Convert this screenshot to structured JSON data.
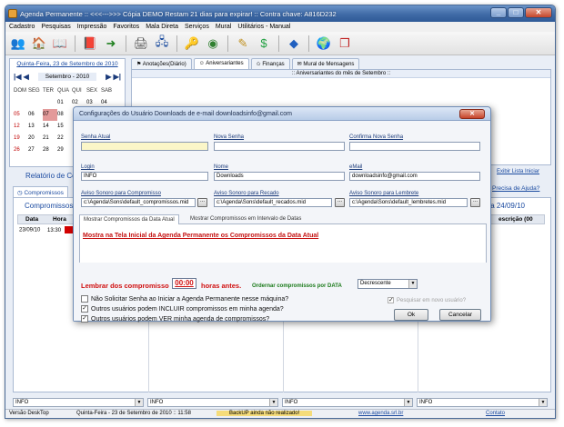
{
  "window": {
    "title": "Agenda Permanente :: <<<--->>> Cópia DEMO Restam 21 dias para expirar! :: Contra chave: A816D232",
    "min": "_",
    "max": "□",
    "close": "✕"
  },
  "menu": [
    "Cadastro",
    "Pesquisas",
    "Impressão",
    "Favoritos",
    "Mala Direta",
    "Serviços",
    "Mural",
    "Utilitários - Manual"
  ],
  "toolbar": {
    "icons": [
      {
        "name": "users-icon",
        "glyph": "👥",
        "color": "#c04010"
      },
      {
        "name": "home-icon",
        "glyph": "🏠",
        "color": "#d08020"
      },
      {
        "name": "book-icon",
        "glyph": "📖",
        "color": "#806030"
      },
      {
        "name": "notebook-icon",
        "glyph": "📕",
        "color": "#a03020"
      },
      {
        "name": "exit-icon",
        "glyph": "➜",
        "color": "#208020"
      },
      {
        "name": "printer-icon",
        "glyph": "🖨",
        "color": "#505050"
      },
      {
        "name": "network-icon",
        "glyph": "🖧",
        "color": "#2050a0"
      },
      {
        "name": "key-icon",
        "glyph": "🔑",
        "color": "#c09010"
      },
      {
        "name": "help-disc-icon",
        "glyph": "◉",
        "color": "#308030"
      },
      {
        "name": "pencil-icon",
        "glyph": "✎",
        "color": "#c09020"
      },
      {
        "name": "dollar-icon",
        "glyph": "$",
        "color": "#20a040"
      },
      {
        "name": "diamond-icon",
        "glyph": "◆",
        "color": "#2060c0"
      },
      {
        "name": "globe-icon",
        "glyph": "🌍",
        "color": "#2080c0"
      },
      {
        "name": "new-window-icon",
        "glyph": "❐",
        "color": "#c02020"
      }
    ]
  },
  "calendar": {
    "date_link": "Quinta-Feira, 23 de Setembro de 2010",
    "month": "Setembro - 2010",
    "weekdays": [
      "DOM",
      "SEG",
      "TER",
      "QUA",
      "QUI",
      "SEX",
      "SAB"
    ],
    "rows": [
      [
        "",
        "",
        "",
        "01",
        "02",
        "03",
        "04"
      ],
      [
        "05",
        "06",
        "07",
        "08",
        "",
        "",
        ""
      ],
      [
        "12",
        "13",
        "14",
        "15",
        "",
        "",
        ""
      ],
      [
        "19",
        "20",
        "21",
        "22",
        "",
        "",
        ""
      ],
      [
        "26",
        "27",
        "28",
        "29",
        "",
        "",
        ""
      ]
    ]
  },
  "tabs": [
    {
      "icon": "⚑",
      "label": "Anotações(Diário)"
    },
    {
      "icon": "☺",
      "label": "Aniversariantes"
    },
    {
      "icon": "✩",
      "label": "Finanças"
    },
    {
      "icon": "✉",
      "label": "Mural de Mensagens"
    }
  ],
  "aniversariantes_header": ":: Aniversariantes do mês de Setembro ::",
  "relatorio": "Relatório de Com",
  "exibir": "Exibir Lista Iniciar",
  "ajuda": "Precisa de Ajuda?",
  "compromissos": {
    "tab": "Compromissos",
    "title": "Compromissos de",
    "title_right": "a 24/09/10",
    "columns": {
      "data": "Data",
      "hora": "Hora",
      "descricao": "escrição (00"
    },
    "row_date": "23/09/10",
    "row_time": "13:30"
  },
  "bottom_combos": [
    "INFO",
    "INFO",
    "INFO",
    "INFO"
  ],
  "statusbar": {
    "version": "Versão DeskTop",
    "date": "Quinta-Feira - 23 de Setembro de 2010 :: 11:58",
    "backup": "BackUP ainda não realizado!",
    "site": "www.agenda.srl.br",
    "contato": "Contato"
  },
  "dialog": {
    "title": "Configurações do Usuário Downloads de e-mail downloadsinfo@gmail.com",
    "close": "✕",
    "labels": {
      "senha_atual": "Senha Atual",
      "nova_senha": "Nova Senha",
      "confirma": "Confirma Nova Senha",
      "login": "Login",
      "nome": "Nome",
      "email": "eMail",
      "aviso_compromisso": "Aviso Sonoro para Compromisso",
      "aviso_recado": "Aviso Sonoro para Recado",
      "aviso_lembrete": "Aviso Sonoro para Lembrete"
    },
    "values": {
      "senha_atual": "",
      "nova_senha": "",
      "confirma": "",
      "login": "INFO",
      "nome": "Downloads",
      "email": "downloadsinfo@gmail.com",
      "aviso_compromisso": "c:\\Agenda\\Sons\\default_compromissos.mid",
      "aviso_recado": "c:\\Agenda\\Sons\\default_recados.mid",
      "aviso_lembrete": "c:\\Agenda\\Sons\\default_lembretes.mid"
    },
    "browse": "...",
    "inner_tabs": [
      "Mostrar Compromissos da Data Atual",
      "Mostrar Compromissos em Intervalo de Datas"
    ],
    "mostrar_text": "Mostra na Tela Inicial da Agenda Permanente os  Compromissos da Data Atual",
    "lembrar": "Lembrar dos compromisso",
    "minutos": "00:00",
    "horas": "horas antes.",
    "ordenar": "Ordernar compromissos por DATA",
    "ordem": "Decrescente",
    "checks": [
      {
        "label": "Não Solicitar Senha ao Iniciar a Agenda Permanente nesse máquina?",
        "checked": false
      },
      {
        "label": "Outros usuários podem INCLUIR compromissos em minha agenda?",
        "checked": true
      },
      {
        "label": "Outros usuários podem VER minha agenda de compromissos?",
        "checked": true
      }
    ],
    "gray_option": "Pesquisar em novo usuário?",
    "ok": "Ok",
    "cancel": "Cancelar"
  }
}
